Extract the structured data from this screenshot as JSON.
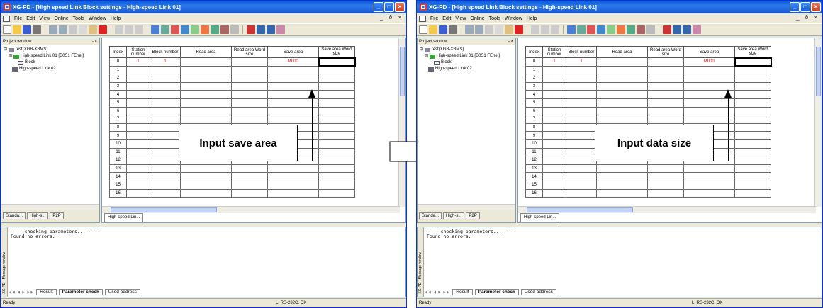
{
  "panels": [
    {
      "title": "XG-PD - [High speed Link Block settings - High-speed Link 01]",
      "menu": [
        "File",
        "Edit",
        "View",
        "Online",
        "Tools",
        "Window",
        "Help"
      ],
      "mdi_controls": "_ ð ×",
      "project_window": {
        "title": "Project window",
        "tree": [
          "test(XGB-XBMS)",
          "High-speed Link 01 [B0S1 FEnet]",
          "Block",
          "High-speed Link 02"
        ],
        "tabs": [
          "Standa...",
          "High-s...",
          "P2P"
        ]
      },
      "grid": {
        "headers": [
          "Index",
          "Station number",
          "Block number",
          "Read area",
          "Read area Word size",
          "Save area",
          "Save area Word size"
        ],
        "first_row": [
          "0",
          "1",
          "1",
          "",
          "",
          "M000",
          ""
        ],
        "indices": [
          "1",
          "2",
          "3",
          "4",
          "5",
          "6",
          "7",
          "8",
          "9",
          "10",
          "11",
          "12",
          "13",
          "14",
          "15",
          "16"
        ]
      },
      "editor_tab": "High-speed Lin...",
      "callout": "Input save area",
      "messages": "---- checking parameters... ----\nFound no errors.",
      "message_side_label": "XG-PD - Message window",
      "message_tabs": [
        "Result",
        "Parameter check",
        "Used address"
      ],
      "status": {
        "left": "Ready",
        "right": "L, RS-232C, OK"
      }
    },
    {
      "title": "XG-PD - [High speed Link Block settings - High-speed Link 01]",
      "menu": [
        "File",
        "Edit",
        "View",
        "Online",
        "Tools",
        "Window",
        "Help"
      ],
      "mdi_controls": "_ ð ×",
      "project_window": {
        "title": "Project window",
        "tree": [
          "test(XGB-XBMS)",
          "High-speed Link 01 [B0S1 FEnet]",
          "Block",
          "High-speed Link 02"
        ],
        "tabs": [
          "Standa...",
          "High-s...",
          "P2P"
        ]
      },
      "grid": {
        "headers": [
          "Index",
          "Station number",
          "Block number",
          "Read area",
          "Read area Word size",
          "Save area",
          "Save area Word size"
        ],
        "first_row": [
          "0",
          "1",
          "1",
          "",
          "",
          "M000",
          ""
        ],
        "indices": [
          "1",
          "2",
          "3",
          "4",
          "5",
          "6",
          "7",
          "8",
          "9",
          "10",
          "11",
          "12",
          "13",
          "14",
          "15",
          "16"
        ]
      },
      "editor_tab": "High-speed Lin...",
      "callout": "Input data size",
      "messages": "---- checking parameters... ----\nFound no errors.",
      "message_side_label": "XG-PD - Message window",
      "message_tabs": [
        "Result",
        "Parameter check",
        "Used address"
      ],
      "status": {
        "left": "Ready",
        "right": "L, RS-232C, OK"
      }
    }
  ],
  "colors": {
    "title_bar": "#1857d0",
    "red_value": "#cc0000",
    "window_face": "#ece9d8"
  }
}
